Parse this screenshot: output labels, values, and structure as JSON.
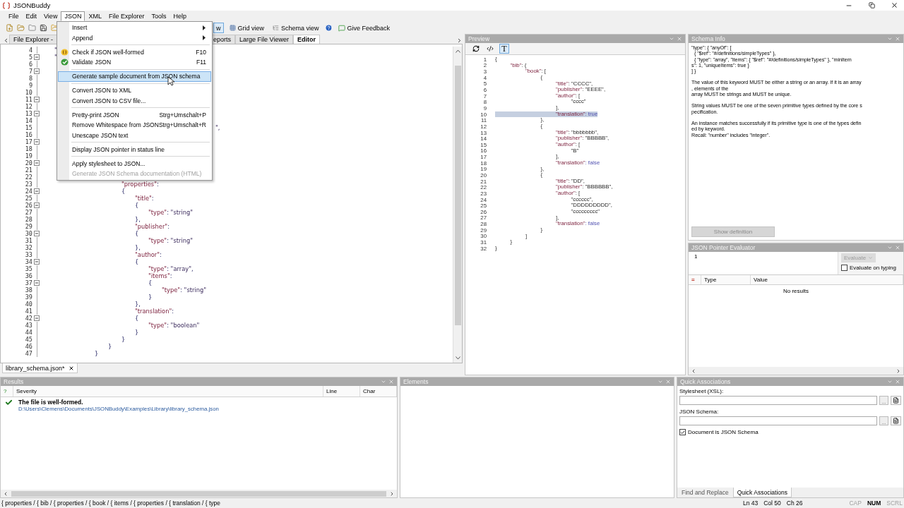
{
  "window": {
    "title": "JSONBuddy"
  },
  "menu_bar": [
    {
      "label": "File",
      "selected": false
    },
    {
      "label": "Edit",
      "selected": false
    },
    {
      "label": "View",
      "selected": false
    },
    {
      "label": "JSON",
      "selected": true
    },
    {
      "label": "XML",
      "selected": false
    },
    {
      "label": "File Explorer",
      "selected": false
    },
    {
      "label": "Tools",
      "selected": false
    },
    {
      "label": "Help",
      "selected": false
    }
  ],
  "toolbar": {
    "views": [
      {
        "label": "w",
        "selected": true
      },
      {
        "label": "Grid view",
        "selected": false
      },
      {
        "label": "Schema view",
        "selected": false
      }
    ],
    "feedback": "Give Feedback"
  },
  "json_menu": [
    {
      "kind": "submenu",
      "label": "Insert",
      "selected": false,
      "disabled": false
    },
    {
      "kind": "submenu",
      "label": "Append",
      "selected": false,
      "disabled": false
    },
    {
      "kind": "separator"
    },
    {
      "kind": "check",
      "label": "Check if JSON well-formed",
      "shortcut": "F10",
      "selected": false,
      "disabled": false
    },
    {
      "kind": "validate",
      "label": "Validate JSON",
      "shortcut": "F11",
      "selected": false,
      "disabled": false
    },
    {
      "kind": "separator"
    },
    {
      "kind": "item",
      "label": "Generate sample document from JSON schema",
      "selected": true,
      "disabled": false
    },
    {
      "kind": "separator"
    },
    {
      "kind": "item",
      "label": "Convert JSON to XML",
      "selected": false,
      "disabled": false
    },
    {
      "kind": "item",
      "label": "Convert JSON to CSV file...",
      "selected": false,
      "disabled": false
    },
    {
      "kind": "separator"
    },
    {
      "kind": "item",
      "label": "Pretty-print JSON",
      "shortcut": "Strg+Umschalt+P",
      "selected": false,
      "disabled": false
    },
    {
      "kind": "item",
      "label": "Remove Whitespace from JSON",
      "shortcut": "Strg+Umschalt+R",
      "selected": false,
      "disabled": false
    },
    {
      "kind": "item",
      "label": "Unescape JSON text",
      "selected": false,
      "disabled": false
    },
    {
      "kind": "separator"
    },
    {
      "kind": "item",
      "label": "Display JSON pointer in status line",
      "selected": false,
      "disabled": false
    },
    {
      "kind": "separator"
    },
    {
      "kind": "item",
      "label": "Apply stylesheet to JSON...",
      "selected": false,
      "disabled": false
    },
    {
      "kind": "item",
      "label": "Generate JSON Schema documentation (HTML)",
      "selected": false,
      "disabled": true
    }
  ],
  "document_tabs": [
    {
      "label": "File Explorer -",
      "selected": false
    },
    {
      "label": "eports",
      "selected": false
    },
    {
      "label": "Large File Viewer",
      "selected": false
    },
    {
      "label": "Editor",
      "selected": true
    }
  ],
  "editor": {
    "lines": [
      {
        "n": "4",
        "kind": "line",
        "code": "\t\""
      },
      {
        "n": "5",
        "kind": "fold",
        "code": "\t\""
      },
      {
        "n": "6",
        "kind": "line"
      },
      {
        "n": "7",
        "kind": "fold"
      },
      {
        "n": "8",
        "kind": "line"
      },
      {
        "n": "9",
        "kind": "line"
      },
      {
        "n": "10",
        "kind": "line"
      },
      {
        "n": "11",
        "kind": "fold"
      },
      {
        "n": "12",
        "kind": "line"
      },
      {
        "n": "13",
        "kind": "fold"
      },
      {
        "n": "14",
        "kind": "line"
      },
      {
        "n": "15",
        "kind": "line",
        "code": "\t\t\t\t\t\t\t\t\t\t\t\t\t\","
      },
      {
        "n": "16",
        "kind": "line"
      },
      {
        "n": "17",
        "kind": "fold"
      },
      {
        "n": "18",
        "kind": "line"
      },
      {
        "n": "19",
        "kind": "line"
      },
      {
        "n": "20",
        "kind": "fold"
      },
      {
        "n": "21",
        "kind": "line"
      },
      {
        "n": "22",
        "kind": "line"
      },
      {
        "n": "23",
        "kind": "line",
        "code": "\t\t\t\t\t\t\"properties\":"
      },
      {
        "n": "24",
        "kind": "fold",
        "code": "\t\t\t\t\t\t{"
      },
      {
        "n": "25",
        "kind": "line",
        "code": "\t\t\t\t\t\t\t\"title\":"
      },
      {
        "n": "26",
        "kind": "fold",
        "code": "\t\t\t\t\t\t\t{"
      },
      {
        "n": "27",
        "kind": "line",
        "code": "\t\t\t\t\t\t\t\t\"type\": \"string\""
      },
      {
        "n": "28",
        "kind": "line",
        "code": "\t\t\t\t\t\t\t},"
      },
      {
        "n": "29",
        "kind": "line",
        "code": "\t\t\t\t\t\t\t\"publisher\":"
      },
      {
        "n": "30",
        "kind": "fold",
        "code": "\t\t\t\t\t\t\t{"
      },
      {
        "n": "31",
        "kind": "line",
        "code": "\t\t\t\t\t\t\t\t\"type\": \"string\""
      },
      {
        "n": "32",
        "kind": "line",
        "code": "\t\t\t\t\t\t\t},"
      },
      {
        "n": "33",
        "kind": "line",
        "code": "\t\t\t\t\t\t\t\"author\":"
      },
      {
        "n": "34",
        "kind": "fold",
        "code": "\t\t\t\t\t\t\t{"
      },
      {
        "n": "35",
        "kind": "line",
        "code": "\t\t\t\t\t\t\t\t\"type\": \"array\","
      },
      {
        "n": "36",
        "kind": "line",
        "code": "\t\t\t\t\t\t\t\t\"items\":"
      },
      {
        "n": "37",
        "kind": "fold",
        "code": "\t\t\t\t\t\t\t\t{"
      },
      {
        "n": "38",
        "kind": "line",
        "code": "\t\t\t\t\t\t\t\t\t\"type\": \"string\""
      },
      {
        "n": "39",
        "kind": "line",
        "code": "\t\t\t\t\t\t\t\t}"
      },
      {
        "n": "40",
        "kind": "line",
        "code": "\t\t\t\t\t\t\t},"
      },
      {
        "n": "41",
        "kind": "line",
        "code": "\t\t\t\t\t\t\t\"translation\":"
      },
      {
        "n": "42",
        "kind": "fold",
        "code": "\t\t\t\t\t\t\t{"
      },
      {
        "n": "43",
        "kind": "line",
        "code": "\t\t\t\t\t\t\t\t\"type\": \"boolean\""
      },
      {
        "n": "44",
        "kind": "line",
        "code": "\t\t\t\t\t\t\t}"
      },
      {
        "n": "45",
        "kind": "line",
        "code": "\t\t\t\t\t\t}"
      },
      {
        "n": "46",
        "kind": "line",
        "code": "\t\t\t\t\t}"
      },
      {
        "n": "47",
        "kind": "line",
        "code": "\t\t\t\t}"
      }
    ]
  },
  "open_files": [
    {
      "label": "library_schema.json*",
      "selected": true
    }
  ],
  "preview": {
    "title": "Preview",
    "tools": [
      {
        "kind": "refresh",
        "selected": false
      },
      {
        "kind": "code",
        "selected": false
      },
      {
        "kind": "text",
        "label": "T",
        "selected": true
      }
    ],
    "lines": [
      {
        "n": "1",
        "code": "{",
        "selected": false
      },
      {
        "n": "2",
        "code": "\t\"bib\": {",
        "selected": false
      },
      {
        "n": "3",
        "code": "\t\t\"book\": [",
        "selected": false
      },
      {
        "n": "4",
        "code": "\t\t\t{",
        "selected": false
      },
      {
        "n": "5",
        "code": "\t\t\t\t\"title\": \"CCCC\",",
        "selected": false
      },
      {
        "n": "6",
        "code": "\t\t\t\t\"publisher\": \"EEEE\",",
        "selected": false
      },
      {
        "n": "7",
        "code": "\t\t\t\t\"author\": [",
        "selected": false
      },
      {
        "n": "8",
        "code": "\t\t\t\t\t\"cccc\"",
        "selected": false
      },
      {
        "n": "9",
        "code": "\t\t\t\t],",
        "selected": false
      },
      {
        "n": "10",
        "code": "\t\t\t\t\"translation\": true",
        "selected": true
      },
      {
        "n": "11",
        "code": "\t\t\t},",
        "selected": false
      },
      {
        "n": "12",
        "code": "\t\t\t{",
        "selected": false
      },
      {
        "n": "13",
        "code": "\t\t\t\t\"title\": \"bbbbbbb\",",
        "selected": false
      },
      {
        "n": "14",
        "code": "\t\t\t\t\"publisher\": \"BBBBB\",",
        "selected": false
      },
      {
        "n": "15",
        "code": "\t\t\t\t\"author\": [",
        "selected": false
      },
      {
        "n": "16",
        "code": "\t\t\t\t\t\"B\"",
        "selected": false
      },
      {
        "n": "17",
        "code": "\t\t\t\t],",
        "selected": false
      },
      {
        "n": "18",
        "code": "\t\t\t\t\"translation\": false",
        "selected": false
      },
      {
        "n": "19",
        "code": "\t\t\t},",
        "selected": false
      },
      {
        "n": "20",
        "code": "\t\t\t{",
        "selected": false
      },
      {
        "n": "21",
        "code": "\t\t\t\t\"title\": \"DD\",",
        "selected": false
      },
      {
        "n": "22",
        "code": "\t\t\t\t\"publisher\": \"BBBBBB\",",
        "selected": false
      },
      {
        "n": "23",
        "code": "\t\t\t\t\"author\": [",
        "selected": false
      },
      {
        "n": "24",
        "code": "\t\t\t\t\t\"cccccc\",",
        "selected": false
      },
      {
        "n": "25",
        "code": "\t\t\t\t\t\"DDDDDDDDD\",",
        "selected": false
      },
      {
        "n": "26",
        "code": "\t\t\t\t\t\"ccccccccc\"",
        "selected": false
      },
      {
        "n": "27",
        "code": "\t\t\t\t],",
        "selected": false
      },
      {
        "n": "28",
        "code": "\t\t\t\t\"translation\": false",
        "selected": false
      },
      {
        "n": "29",
        "code": "\t\t\t}",
        "selected": false
      },
      {
        "n": "30",
        "code": "\t\t]",
        "selected": false
      },
      {
        "n": "31",
        "code": "\t}",
        "selected": false
      },
      {
        "n": "32",
        "code": "}",
        "selected": false
      }
    ]
  },
  "schema_info": {
    "title": "Schema Info",
    "code": [
      "\"type\": { \"anyOf\": [",
      "  { \"$ref\": \"#/definitions/simpleTypes\" },",
      "  { \"type\": \"array\", \"items\": { \"$ref\": \"#/definitions/simpleTypes\" }, \"minItem",
      "s\": 1, \"uniqueItems\": true }",
      "] }"
    ],
    "paragraphs": [
      [
        "The value of this keyword MUST be either a string or an array. If it is an array",
        ", elements of the",
        "array MUST be strings and MUST be unique."
      ],
      [
        "String values MUST be one of the seven primitive types defined by the core s",
        "pecification."
      ],
      [
        "An instance matches successfully if its primitive type is one of the types defin",
        "ed by keyword.",
        "Recall: \"number\" includes \"integer\"."
      ]
    ],
    "button": {
      "label": "Show definition",
      "disabled": true
    }
  },
  "pointer_evaluator": {
    "title": "JSON Pointer Evaluator",
    "line_numbers": [
      "1"
    ],
    "evaluate": {
      "label": "Evaluate",
      "disabled": true
    },
    "evaluate_on_typing": {
      "label": "Evaluate on typing",
      "checked": false
    },
    "columns": [
      "=",
      "Type",
      "Value"
    ],
    "empty_text": "No results"
  },
  "results": {
    "title": "Results",
    "columns": [
      "?",
      "Severity",
      "Line",
      "Char"
    ],
    "rows": [
      {
        "message": "The file is well-formed.",
        "path": "D:\\Users\\Clemens\\Documents\\JSONBuddy\\Examples\\Library\\library_schema.json"
      }
    ]
  },
  "elements": {
    "title": "Elements"
  },
  "quick_associations": {
    "title": "Quick Associations",
    "fields": [
      {
        "label": "Stylesheet (XSL):",
        "browse": "..."
      },
      {
        "label": "JSON Schema:",
        "browse": "..."
      }
    ],
    "document_is_schema": {
      "label": "Document is JSON Schema",
      "checked": true
    },
    "tabs": [
      {
        "label": "Find and Replace",
        "selected": false
      },
      {
        "label": "Quick Associations",
        "selected": true
      }
    ]
  },
  "status_bar": {
    "path": "{ properties / { bib / { properties / { book / { items / { properties / { translation / { type",
    "position": [
      "Ln 43",
      "Col 50",
      "Ch 26"
    ],
    "keys": [
      {
        "label": "CAP",
        "on": false
      },
      {
        "label": "NUM",
        "on": true
      },
      {
        "label": "SCRL",
        "on": false
      }
    ]
  }
}
